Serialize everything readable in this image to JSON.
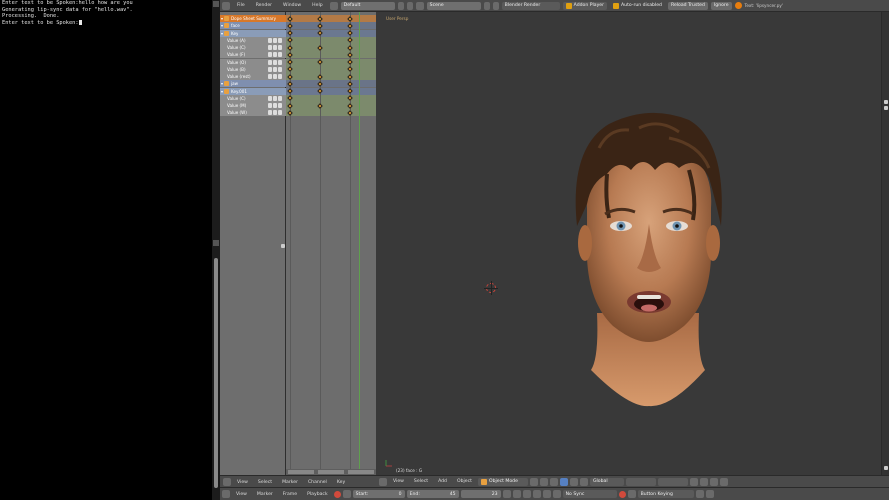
{
  "terminal": {
    "lines": [
      "Enter text to be Spoken:hello how are you",
      "Generating lip-sync data for \"hello.wav\".",
      "Processing.  Done.",
      "",
      "",
      "Enter text to be Spoken:"
    ]
  },
  "info_header": {
    "menus": [
      "File",
      "Render",
      "Window",
      "Help"
    ],
    "screen_layout": "Default",
    "scene": "Scene",
    "render_engine": "Blender Render",
    "addon_status": "Addon Player",
    "autorun": "Auto-run disabled",
    "reload_trusted": "Reload Trusted",
    "ignore": "Ignore",
    "stats": "Text: 'lipsyncer.py'"
  },
  "channels": [
    {
      "kind": "summary",
      "label": "Dope Sheet Summary"
    },
    {
      "kind": "obj",
      "label": "face"
    },
    {
      "kind": "action",
      "label": "Key"
    },
    {
      "kind": "fc",
      "label": "Value (A)"
    },
    {
      "kind": "fc",
      "label": "Value (C)"
    },
    {
      "kind": "fc",
      "label": "Value (F)"
    },
    {
      "kind": "fc",
      "label": "Value (O)"
    },
    {
      "kind": "fc",
      "label": "Value (B)"
    },
    {
      "kind": "fc",
      "label": "Value (rest)"
    },
    {
      "kind": "obj",
      "label": "jaw"
    },
    {
      "kind": "action",
      "label": "Key.001"
    },
    {
      "kind": "fc",
      "label": "Value (C)"
    },
    {
      "kind": "fc",
      "label": "Value (M)"
    },
    {
      "kind": "fc",
      "label": "Value (W)"
    }
  ],
  "viewport": {
    "view_label": "User Persp",
    "object_label": "(23) face : G"
  },
  "view3d_header": {
    "menus": [
      "View",
      "Select",
      "Add",
      "Object"
    ],
    "mode": "Object Mode",
    "orientation": "Global"
  },
  "ds_header": {
    "menus": [
      "View",
      "Select",
      "Marker",
      "Channel",
      "Key"
    ]
  },
  "timeline_header": {
    "menus": [
      "View",
      "Marker",
      "Frame",
      "Playback"
    ],
    "start_label": "Start:",
    "start_value": "0",
    "end_label": "End:",
    "end_value": "45",
    "current_frame": "23",
    "sync": "No Sync",
    "keying": "Button Keying"
  }
}
